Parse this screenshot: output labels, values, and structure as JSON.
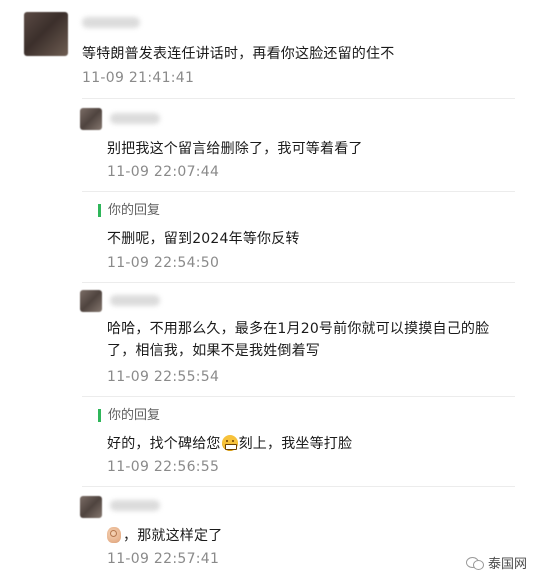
{
  "comments": [
    {
      "message": "等特朗普发表连任讲话时，再看你这脸还留的住不",
      "time": "11-09 21:41:41"
    },
    {
      "message": "别把我这个留言给删除了，我可等着看了",
      "time": "11-09 22:07:44"
    },
    {
      "reply_label": "你的回复",
      "message": "不删呢，留到2024年等你反转",
      "time": "11-09 22:54:50"
    },
    {
      "message": "哈哈，不用那么久，最多在1月20号前你就可以摸摸自己的脸了，相信我，如果不是我姓倒着写",
      "time": "11-09 22:55:54"
    },
    {
      "reply_label": "你的回复",
      "message_before": "好的，找个碑给您",
      "message_after": "刻上，我坐等打脸",
      "time": "11-09 22:56:55"
    },
    {
      "message": "，那就这样定了",
      "time": "11-09 22:57:41"
    }
  ],
  "icons": {
    "grin_emoji": "grinning-face-icon",
    "ok_emoji": "ok-hand-icon",
    "wechat": "wechat-icon"
  },
  "watermark": "泰国网",
  "colors": {
    "reply_bar": "#2fb65a",
    "time": "#8a8a8a"
  }
}
